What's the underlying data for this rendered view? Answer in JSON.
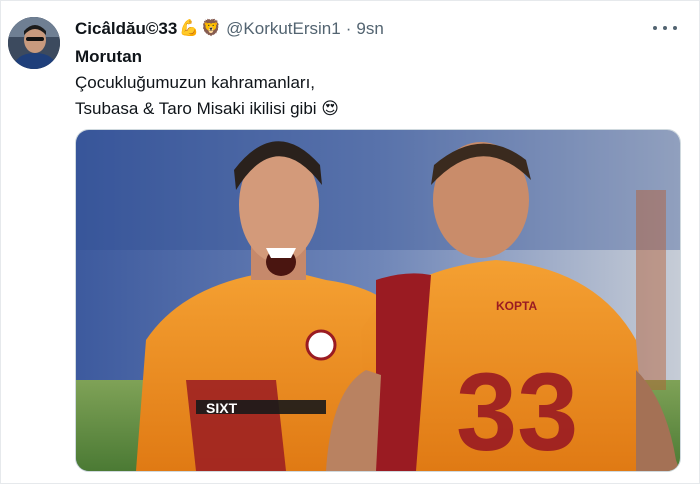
{
  "tweet": {
    "author_name": "Cicâldău©33",
    "author_emojis": [
      "💪",
      "🦁"
    ],
    "handle": "@KorkutErsin1",
    "separator": "·",
    "timestamp": "9sn",
    "text_lines": [
      "Morutan",
      "Çocukluğumuzun kahramanları,",
      "Tsubasa & Taro Misaki ikilisi gibi"
    ],
    "text_emoji": "😍",
    "media": {
      "jersey_number": "33",
      "sponsor_text": "SIXT",
      "back_name": "KOPTA"
    }
  },
  "colors": {
    "handle_gray": "#536471",
    "text": "#0f1419",
    "jersey_orange": "#f08a1c",
    "jersey_red": "#9a1b22"
  },
  "icons": [
    "more-options-icon"
  ]
}
